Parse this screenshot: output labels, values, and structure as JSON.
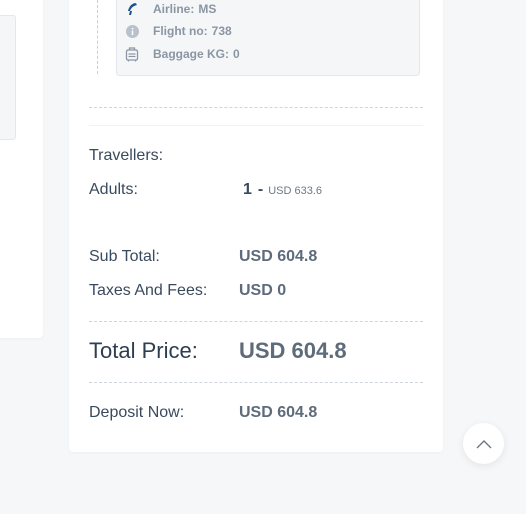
{
  "flight": {
    "airline_label": "Airline:",
    "airline_value": "MS",
    "flight_no_label": "Flight no:",
    "flight_no_value": "738",
    "baggage_label": "Baggage KG:",
    "baggage_value": "0"
  },
  "pricing": {
    "travellers_label": "Travellers:",
    "adults_label": "Adults:",
    "adults_count": "1",
    "adults_dash": "-",
    "adults_price": "USD 633.6",
    "subtotal_label": "Sub Total:",
    "subtotal_value": "USD 604.8",
    "taxes_label": "Taxes And Fees:",
    "taxes_value": "USD 0",
    "total_label": "Total Price:",
    "total_value": "USD 604.8",
    "deposit_label": "Deposit Now:",
    "deposit_value": "USD 604.8"
  },
  "icons": {
    "airline": "airline-logo-icon",
    "flight_no": "info-icon",
    "baggage": "luggage-icon",
    "scroll_top": "chevron-up-icon"
  }
}
